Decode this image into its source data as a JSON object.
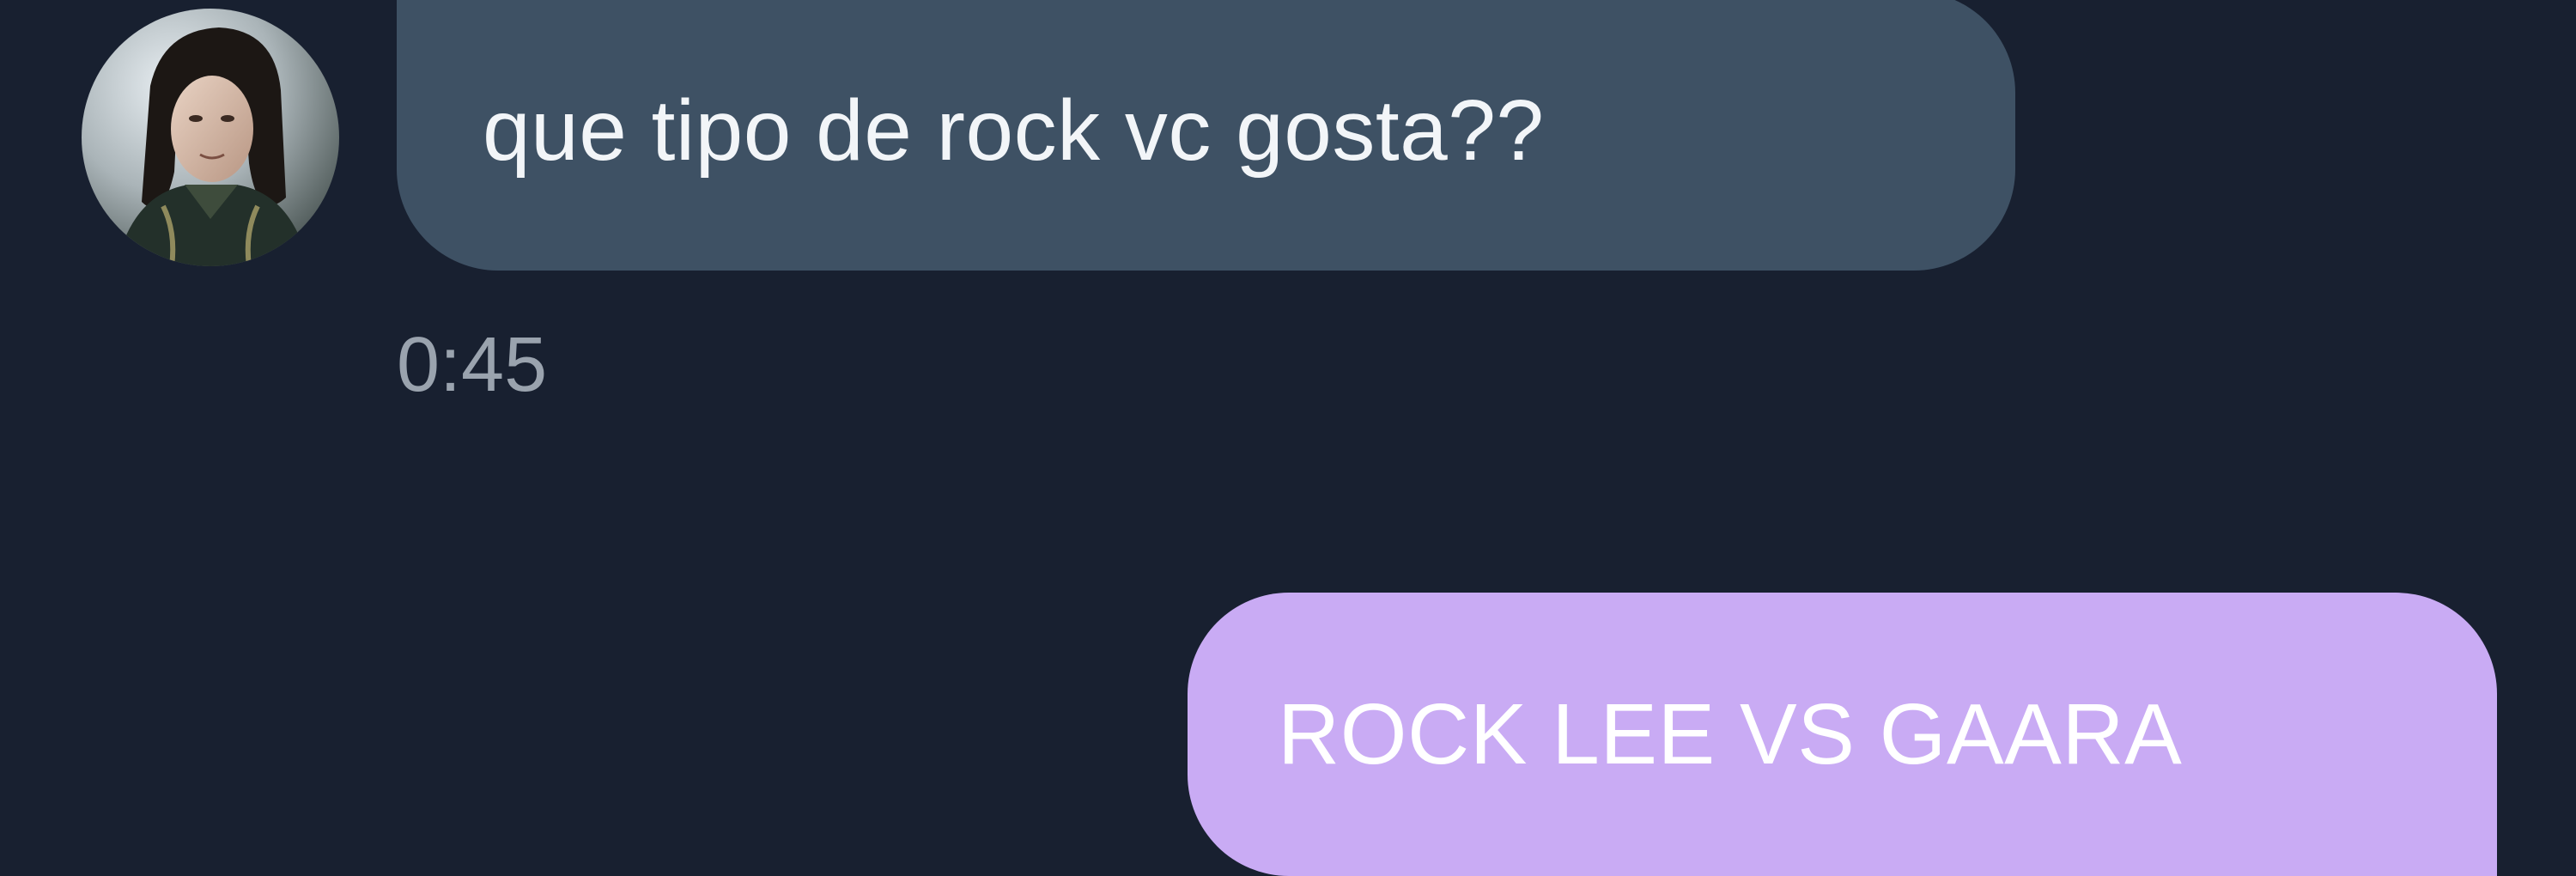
{
  "conversation": {
    "incoming": {
      "text": "que tipo de rock vc gosta??",
      "time": "0:45",
      "avatar_icon": "user-avatar-photo"
    },
    "outgoing": {
      "text": "ROCK LEE VS GAARA"
    }
  },
  "colors": {
    "background": "#182030",
    "incoming_bubble": "#3e5164",
    "outgoing_bubble": "#c9abf4",
    "timestamp": "#9aa3ae"
  }
}
